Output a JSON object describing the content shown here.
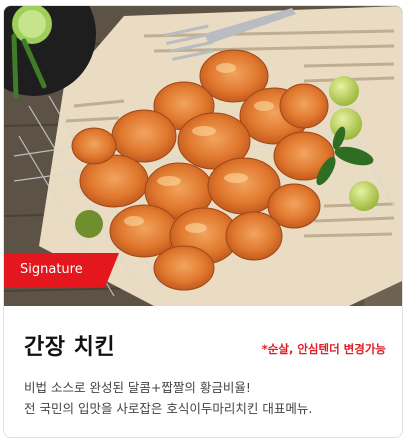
{
  "product": {
    "badge": "Signature",
    "title": "간장 치킨",
    "note": "*순살, 안심텐더 변경가능",
    "description_lines": [
      "비법 소스로 완성된 달콤+짭짤의 황금비율!",
      "전 국민의 입맛을 사로잡은 호식이두마리치킨 대표메뉴."
    ]
  },
  "colors": {
    "badge_bg": "#e4171f",
    "note_text": "#e01c24"
  }
}
